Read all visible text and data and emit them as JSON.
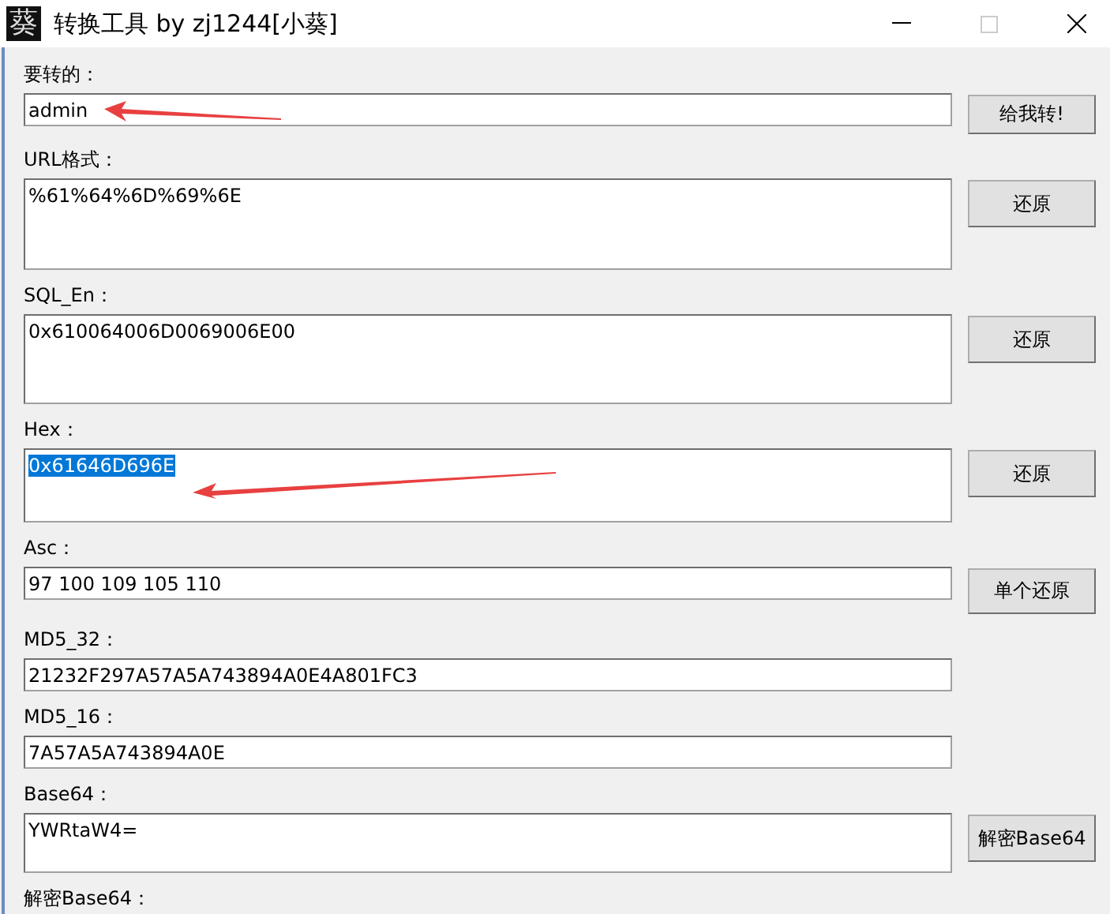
{
  "window": {
    "icon_glyph": "葵",
    "title": "转换工具 by zj1244[小葵]"
  },
  "fields": [
    {
      "label": "要转的：",
      "kind": "line",
      "value": "admin",
      "selected": false,
      "button": "给我转!"
    },
    {
      "label": "URL格式：",
      "kind": "box",
      "value": "%61%64%6D%69%6E",
      "selected": false,
      "button": "还原"
    },
    {
      "label": "SQL_En：",
      "kind": "box",
      "value": "0x610064006D0069006E00",
      "selected": false,
      "button": "还原"
    },
    {
      "label": "Hex：",
      "kind": "box",
      "value": "0x61646D696E",
      "selected": true,
      "button": "还原"
    },
    {
      "label": "Asc：",
      "kind": "line",
      "value": "97 100 109 105 110",
      "selected": false,
      "button": "单个还原"
    },
    {
      "label": "MD5_32：",
      "kind": "line",
      "value": "21232F297A57A5A743894A0E4A801FC3",
      "selected": false
    },
    {
      "label": "MD5_16：",
      "kind": "line",
      "value": "7A57A5A743894A0E",
      "selected": false
    },
    {
      "label": "Base64：",
      "kind": "box",
      "value": "YWRtaW4=",
      "selected": false,
      "button": "解密Base64"
    }
  ],
  "last_label": "解密Base64："
}
